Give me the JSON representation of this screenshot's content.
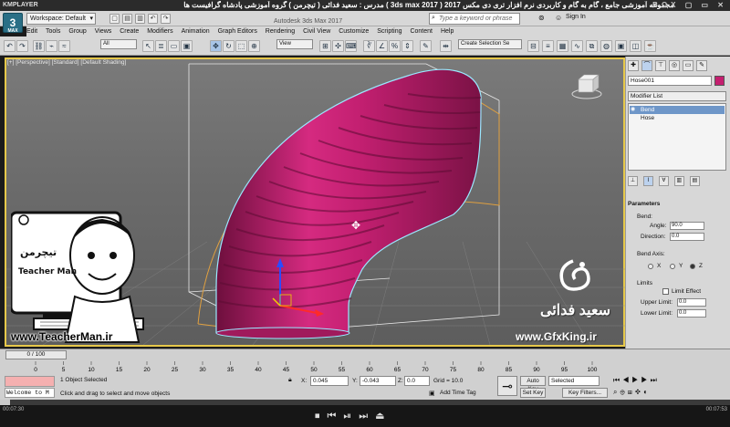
{
  "player": {
    "logo": "KMPLAYER",
    "title": "مجموعه آموزشی جامع ، گام به گام و کاربردی نرم افزار تری دی مکس 2017 ( 3ds max 2017 )   مدرس : سعید فدائی ( تیچرمن ) گروه آموزشی پادشاه گرافیست ها",
    "window_controls": "BOX ▢ ▭ ✕",
    "time_left": "00:07:30",
    "time_right": "00:07:53",
    "progress": 0.014
  },
  "app": {
    "logo_text": "3",
    "logo_sub": "MAX",
    "workspace": "Workspace: Default",
    "title": "Autodesk 3ds Max 2017",
    "search_placeholder": "Type a keyword or phrase",
    "sign_in": "Sign In"
  },
  "menu": [
    "Edit",
    "Tools",
    "Group",
    "Views",
    "Create",
    "Modifiers",
    "Animation",
    "Graph Editors",
    "Rendering",
    "Civil View",
    "Customize",
    "Scripting",
    "Content",
    "Help"
  ],
  "toolbar": {
    "filter": "All",
    "ref_coord": "View",
    "selection_set": "Create Selection Se"
  },
  "viewport": {
    "label": "[+] [Perspective] [Standard] [Default Shading]",
    "object_color": "#c21f70"
  },
  "watermark": {
    "left_brand_fa": "تیچرمن",
    "left_brand_en": "Teacher Man",
    "left_url": "www.TeacherMan.ir",
    "right_name": "سعید فدائی",
    "right_url": "www.GfxKing.ir"
  },
  "command_panel": {
    "object_name": "Hose001",
    "modifier_list": "Modifier List",
    "stack": [
      "Bend",
      "Hose"
    ],
    "params_title": "Parameters",
    "bend_label": "Bend:",
    "angle_label": "Angle:",
    "angle_value": "90.0",
    "direction_label": "Direction:",
    "direction_value": "0.0",
    "axis_label": "Bend Axis:",
    "axis_x": "X",
    "axis_y": "Y",
    "axis_z": "Z",
    "limits_label": "Limits",
    "limit_effect": "Limit Effect",
    "upper_label": "Upper Limit:",
    "upper_value": "0.0",
    "lower_label": "Lower Limit:",
    "lower_value": "0.0"
  },
  "timeline": {
    "slider": "0 / 100",
    "ticks": [
      "0",
      "5",
      "10",
      "15",
      "20",
      "25",
      "30",
      "35",
      "40",
      "45",
      "50",
      "55",
      "60",
      "65",
      "70",
      "75",
      "80",
      "85",
      "90",
      "95",
      "100"
    ]
  },
  "status": {
    "listener": "Welcome to M",
    "selected": "1 Object Selected",
    "prompt": "Click and drag to select and move objects",
    "x_label": "X:",
    "x_value": "0.045",
    "y_label": "Y:",
    "y_value": "-0.043",
    "z_label": "Z:",
    "z_value": "0.0",
    "grid": "Grid = 10.0",
    "add_time_tag": "Add Time Tag",
    "auto_key": "Auto Key",
    "selected_dd": "Selected",
    "set_key": "Set Key",
    "key_filters": "Key Filters..."
  }
}
